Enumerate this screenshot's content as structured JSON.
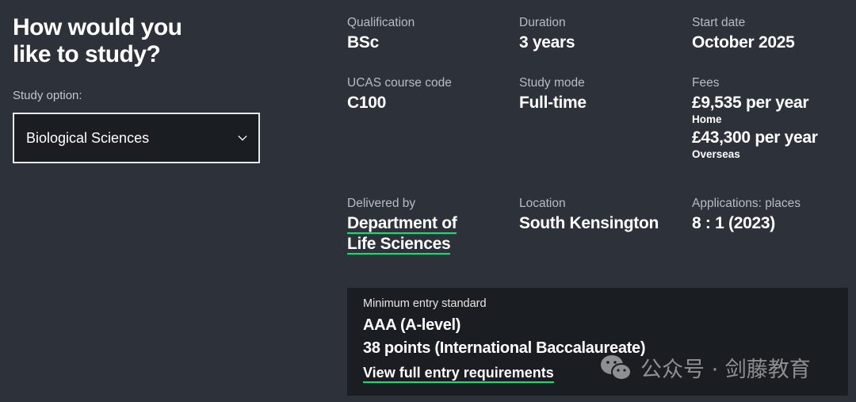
{
  "left": {
    "heading_line1": "How would you",
    "heading_line2": "like to study?",
    "study_option_label": "Study option:",
    "study_option_value": "Biological Sciences"
  },
  "details": {
    "qualification": {
      "label": "Qualification",
      "value": "BSc"
    },
    "duration": {
      "label": "Duration",
      "value": "3 years"
    },
    "start_date": {
      "label": "Start date",
      "value": "October 2025"
    },
    "ucas_code": {
      "label": "UCAS course code",
      "value": "C100"
    },
    "study_mode": {
      "label": "Study mode",
      "value": "Full-time"
    },
    "fees": {
      "label": "Fees",
      "home_value": "£9,535 per year",
      "home_label": "Home",
      "overseas_value": "£43,300 per year",
      "overseas_label": "Overseas"
    },
    "delivered_by": {
      "label": "Delivered by",
      "line1": "Department of",
      "line2": "Life Sciences"
    },
    "location": {
      "label": "Location",
      "value": "South Kensington"
    },
    "applications": {
      "label": "Applications: places",
      "value": "8 : 1 (2023)"
    }
  },
  "entry": {
    "label": "Minimum entry standard",
    "alevel": "AAA (A-level)",
    "ib": "38 points (International Baccalaureate)",
    "link": "View full entry requirements"
  },
  "watermark": {
    "text": "公众号 · 剑藤教育",
    "icon": "wechat-icon"
  },
  "colors": {
    "background": "#2c313a",
    "panel": "#1a1d21",
    "accent_underline": "#00e676"
  }
}
